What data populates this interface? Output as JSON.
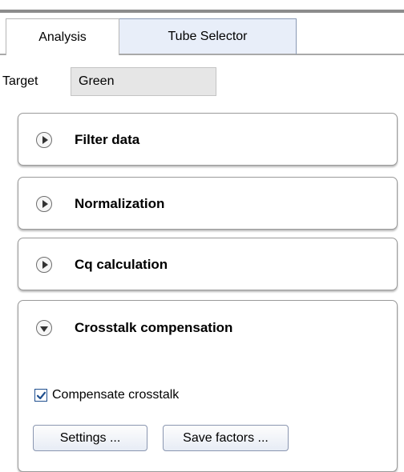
{
  "tabs": [
    {
      "label": "Analysis",
      "active": true
    },
    {
      "label": "Tube Selector",
      "active": false
    }
  ],
  "target": {
    "label": "Target",
    "value": "Green"
  },
  "panels": [
    {
      "title": "Filter data",
      "expanded": false
    },
    {
      "title": "Normalization",
      "expanded": false
    },
    {
      "title": "Cq calculation",
      "expanded": false
    },
    {
      "title": "Crosstalk compensation",
      "expanded": true
    }
  ],
  "crosstalk": {
    "checkbox_label": "Compensate crosstalk",
    "checked": true,
    "settings_label": "Settings ...",
    "save_factors_label": "Save factors ..."
  },
  "colors": {
    "accent": "#1f4f8f",
    "tab_inactive_bg": "#e8eef9"
  }
}
